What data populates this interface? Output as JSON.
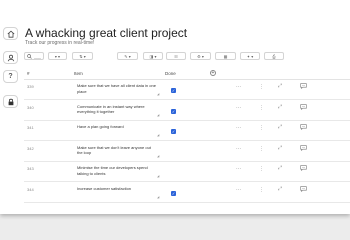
{
  "sidebar": {
    "icons": [
      "home-icon",
      "user-icon",
      "help-icon",
      "lock-icon"
    ]
  },
  "header": {
    "title": "A whacking great client project",
    "subtitle": "Track our progress in real-time!"
  },
  "toolbar": {
    "items": [
      "search",
      "filter",
      "sort",
      "edit",
      "view",
      "group",
      "options",
      "table",
      "settings",
      "print"
    ]
  },
  "table": {
    "columns": {
      "id": "#",
      "item": "Item",
      "done": "Done",
      "add": "+"
    },
    "rows": [
      {
        "id": "339",
        "item": "Make sure that we have all client data in one place",
        "done": true
      },
      {
        "id": "340",
        "item": "Communicate in an instant way where everything it together",
        "done": true
      },
      {
        "id": "341",
        "item": "Have a plan going forward",
        "done": true
      },
      {
        "id": "342",
        "item": "Make sure that we don't leave anyone out the loop",
        "done": false
      },
      {
        "id": "343",
        "item": "Minimise the time our developers spend talking to clients",
        "done": false
      },
      {
        "id": "344",
        "item": "Increase customer satisfaction",
        "done": true
      }
    ]
  },
  "colors": {
    "accent": "#2b63d9"
  }
}
